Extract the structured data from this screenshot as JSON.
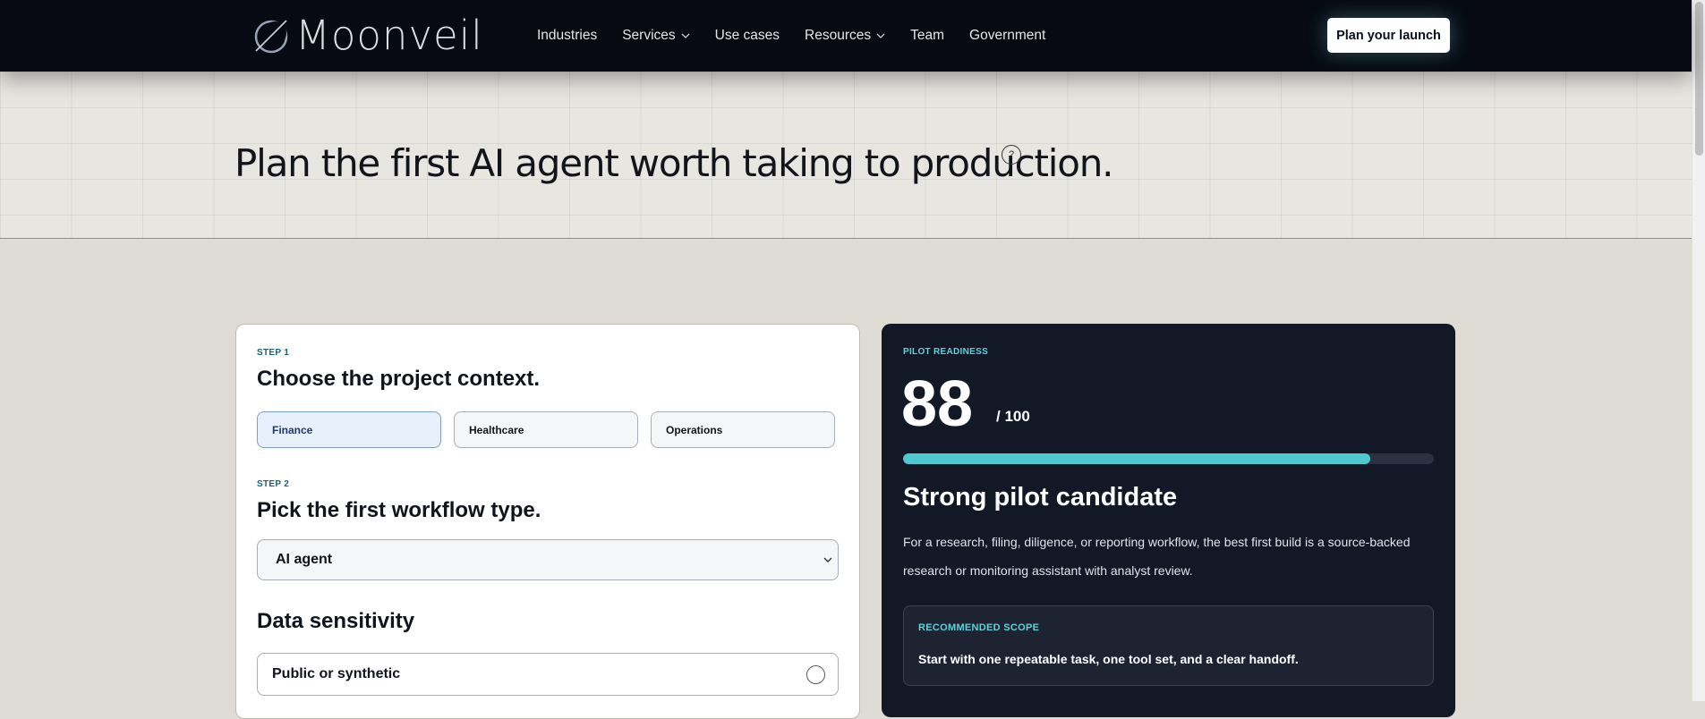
{
  "nav": {
    "logo_text": "Moonveil",
    "links": [
      {
        "label": "Industries",
        "has_dropdown": false
      },
      {
        "label": "Services",
        "has_dropdown": true
      },
      {
        "label": "Use cases",
        "has_dropdown": false
      },
      {
        "label": "Resources",
        "has_dropdown": true
      },
      {
        "label": "Team",
        "has_dropdown": false
      },
      {
        "label": "Government",
        "has_dropdown": false
      }
    ],
    "cta_label": "Plan your launch"
  },
  "hero": {
    "title": "Plan the first AI agent worth taking to production.",
    "help_glyph": "?"
  },
  "planner": {
    "step1": {
      "kicker": "STEP 1",
      "heading": "Choose the project context.",
      "options": [
        "Finance",
        "Healthcare",
        "Operations"
      ],
      "selected": "Finance"
    },
    "step2": {
      "kicker": "STEP 2",
      "heading": "Pick the first workflow type.",
      "selected_value": "AI agent"
    },
    "sensitivity": {
      "heading": "Data sensitivity",
      "first_option": "Public or synthetic"
    }
  },
  "readiness": {
    "kicker": "PILOT READINESS",
    "score": "88",
    "max": "/ 100",
    "score_fraction": 0.88,
    "verdict": "Strong pilot candidate",
    "description": "For a research, filing, diligence, or reporting workflow, the best first build is a source-backed research or monitoring assistant with analyst review.",
    "scope_kicker": "RECOMMENDED SCOPE",
    "scope_text": "Start with one repeatable task, one tool set, and a clear handoff."
  },
  "colors": {
    "nav_bg": "#070a13",
    "accent_teal": "#4fc9d0",
    "dark_card": "#121826",
    "page_bg": "#dfdcd6"
  }
}
